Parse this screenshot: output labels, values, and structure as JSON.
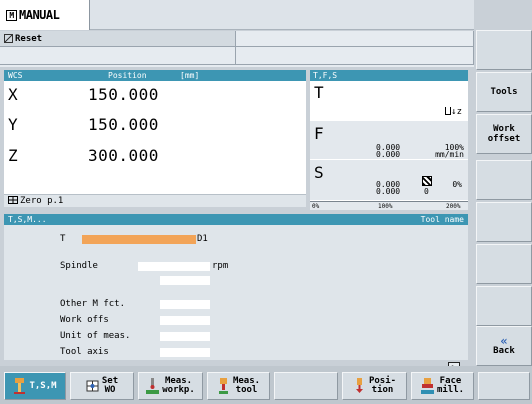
{
  "top": {
    "mode": "MANUAL",
    "reset": "Reset"
  },
  "wcs": {
    "header": "WCS",
    "position_header": "Position",
    "unit": "[mm]",
    "axes": [
      {
        "name": "X",
        "value": "150.000"
      },
      {
        "name": "Y",
        "value": "150.000"
      },
      {
        "name": "Z",
        "value": "300.000"
      }
    ],
    "zero": "Zero p.1"
  },
  "tfs": {
    "header": "T,F,S",
    "t_letter": "T",
    "t_small": "↓z",
    "f_letter": "F",
    "f_val1": "0.000",
    "f_val2": "0.000",
    "f_pct": "100%",
    "f_unit": "mm/min",
    "s_letter": "S",
    "s_val1": "0.000",
    "s_val2": "0.000",
    "s_pct": "0%",
    "s_zero": "0",
    "scale": [
      "0%",
      "100%",
      "200%"
    ]
  },
  "tsm": {
    "header": "T,S,M...",
    "tool_name": "Tool name",
    "t_label": "T",
    "d_label": "D1",
    "spindle_label": "Spindle",
    "rpm": "rpm",
    "other_m": "Other M fct.",
    "work_offs": "Work offs",
    "unit_meas": "Unit of meas.",
    "tool_axis": "Tool axis"
  },
  "softkeys_right": [
    {
      "label": ""
    },
    {
      "label": "Tools"
    },
    {
      "label": "Work offset"
    },
    {
      "label": ""
    },
    {
      "label": ""
    },
    {
      "label": ""
    },
    {
      "label": ""
    },
    {
      "label": "Back",
      "icon": "«"
    }
  ],
  "softkeys_bottom": [
    {
      "label": "T,S,M"
    },
    {
      "label": "Set WO"
    },
    {
      "label": "Meas. workp."
    },
    {
      "label": "Meas. tool"
    },
    {
      "label": ""
    },
    {
      "label": "Posi- tion"
    },
    {
      "label": "Face mill."
    }
  ],
  "colors": {
    "header_blue": "#3d96b3",
    "tool_bar": "#f2a458",
    "softkey_bg": "#d6dde3"
  }
}
